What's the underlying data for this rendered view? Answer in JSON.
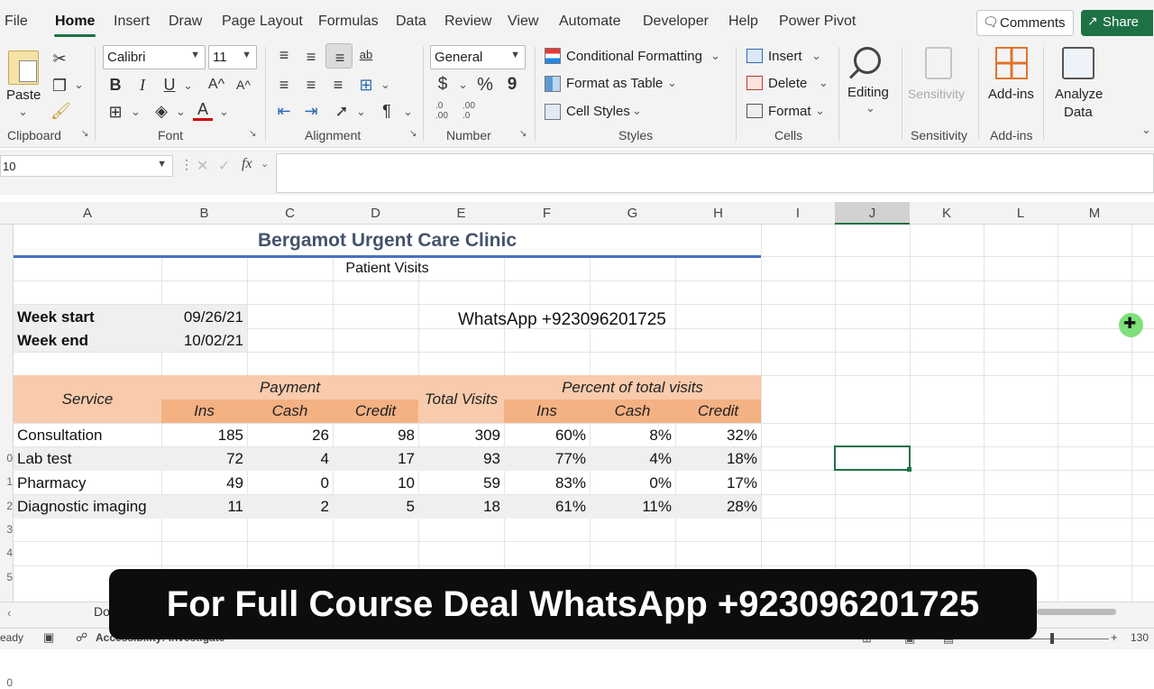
{
  "menu": {
    "tabs": [
      "File",
      "Home",
      "Insert",
      "Draw",
      "Page Layout",
      "Formulas",
      "Data",
      "Review",
      "View",
      "Automate",
      "Developer",
      "Help",
      "Power Pivot"
    ],
    "comments": "Comments",
    "share": "Share"
  },
  "ribbon": {
    "clipboard": {
      "paste": "Paste",
      "label": "Clipboard"
    },
    "font": {
      "name": "Calibri",
      "size": "11",
      "label": "Font"
    },
    "alignment": {
      "label": "Alignment"
    },
    "number": {
      "format": "General",
      "label": "Number",
      "currency": "$",
      "percent": "%",
      "comma": "9",
      "inc_dec": ".0\n.00",
      "dec_dec": ".00\n.0"
    },
    "styles": {
      "conditional": "Conditional Formatting",
      "table": "Format as Table",
      "cell": "Cell Styles",
      "label": "Styles"
    },
    "cells": {
      "insert": "Insert",
      "delete": "Delete",
      "format": "Format",
      "label": "Cells"
    },
    "editing": {
      "label": "Editing"
    },
    "sensitivity": {
      "button": "Sensitivity",
      "label": "Sensitivity"
    },
    "addins": {
      "button": "Add-ins",
      "label": "Add-ins"
    },
    "analyze": {
      "line1": "Analyze",
      "line2": "Data"
    },
    "font_buttons": {
      "bold": "B",
      "italic": "I",
      "underline": "U",
      "grow": "A^",
      "shrink": "A^"
    },
    "wrap_icon": "ab"
  },
  "formula_bar": {
    "name_box": "10",
    "fx": "fx",
    "value": ""
  },
  "columns": [
    "A",
    "B",
    "C",
    "D",
    "E",
    "F",
    "G",
    "H",
    "I",
    "J",
    "K",
    "L",
    "M"
  ],
  "rows": [
    "0",
    "1",
    "2",
    "3",
    "4",
    "5"
  ],
  "sheet": {
    "title": "Bergamot Urgent Care Clinic",
    "subtitle": "Patient Visits",
    "week_start_label": "Week start",
    "week_start": "09/26/21",
    "week_end_label": "Week end",
    "week_end": "10/02/21",
    "whatsapp": "WhatsApp +923096201725",
    "headers": {
      "service": "Service",
      "payment": "Payment",
      "total": "Total Visits",
      "percent": "Percent of total visits",
      "sub": [
        "Ins",
        "Cash",
        "Credit",
        "Ins",
        "Cash",
        "Credit"
      ]
    },
    "data": [
      [
        "Consultation",
        "185",
        "26",
        "98",
        "309",
        "60%",
        "8%",
        "32%"
      ],
      [
        "Lab test",
        "72",
        "4",
        "17",
        "93",
        "77%",
        "4%",
        "18%"
      ],
      [
        "Pharmacy",
        "49",
        "0",
        "10",
        "59",
        "83%",
        "0%",
        "17%"
      ],
      [
        "Diagnostic imaging",
        "11",
        "2",
        "5",
        "18",
        "61%",
        "11%",
        "28%"
      ]
    ]
  },
  "sheet_tab": "Do",
  "status": {
    "ready": "eady",
    "accessibility": "Accessibility: Investigate",
    "zoom": "130"
  },
  "banner": "For Full Course Deal  WhatsApp +923096201725",
  "colors": {
    "accent": "#1e7145",
    "header_dark": "#f4b183",
    "header_light": "#f8cbad",
    "band": "#efefef",
    "title": "#44546a"
  }
}
